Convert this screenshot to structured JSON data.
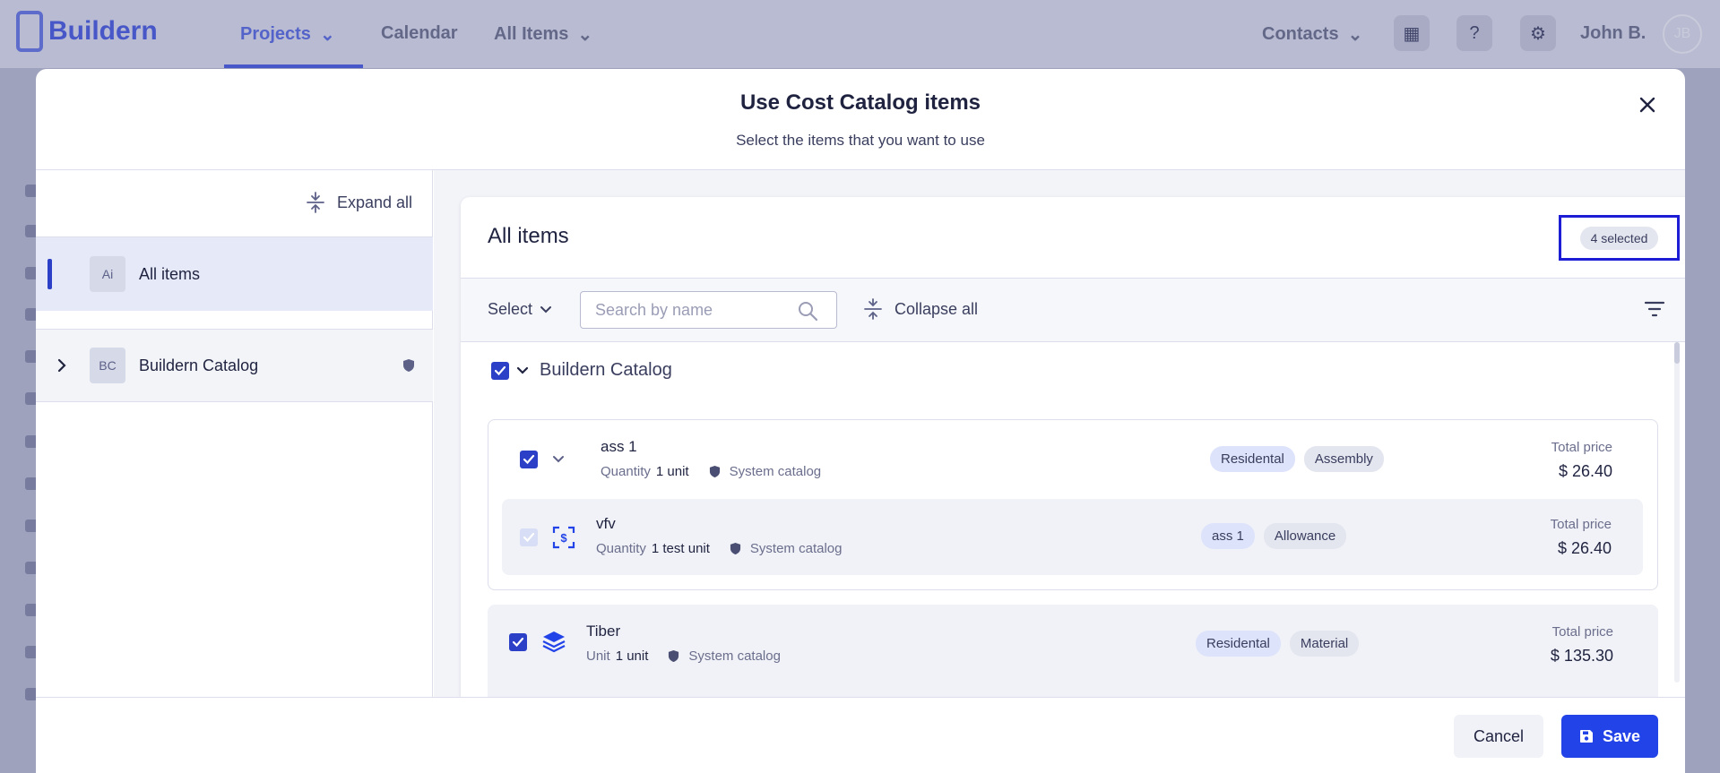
{
  "app": {
    "brand": "Buildern",
    "nav": [
      {
        "label": "Projects"
      },
      {
        "label": "Calendar"
      },
      {
        "label": "All Items"
      }
    ],
    "contacts_label": "Contacts",
    "user_name": "John B.",
    "user_initials": "JB"
  },
  "modal": {
    "title": "Use Cost Catalog items",
    "subtitle": "Select the items that you want to use",
    "expand_all_label": "Expand all",
    "tree": [
      {
        "initials": "Ai",
        "label": "All items",
        "selected": true
      },
      {
        "initials": "BC",
        "label": "Buildern Catalog",
        "selected": false
      }
    ],
    "main": {
      "title": "All items",
      "selected_count": "4 selected",
      "select_label": "Select",
      "search_placeholder": "Search by name",
      "search_value": "",
      "collapse_all_label": "Collapse all",
      "group": {
        "label": "Buildern Catalog",
        "checked": true
      },
      "items": [
        {
          "name": "ass 1",
          "qty_label": "Quantity",
          "qty_value": "1 unit",
          "source": "System catalog",
          "tags": [
            "Residental",
            "Assembly"
          ],
          "price_label": "Total price",
          "price": "$ 26.40",
          "checked": true,
          "children": [
            {
              "name": "vfv",
              "qty_label": "Quantity",
              "qty_value": "1 test unit",
              "source": "System catalog",
              "tags": [
                "ass 1",
                "Allowance"
              ],
              "price_label": "Total price",
              "price": "$ 26.40",
              "checked": true,
              "disabled": true
            }
          ]
        },
        {
          "name": "Tiber",
          "qty_label": "Unit",
          "qty_value": "1 unit",
          "source": "System catalog",
          "tags": [
            "Residental",
            "Material"
          ],
          "price_label": "Total price",
          "price": "$ 135.30",
          "checked": true
        }
      ]
    },
    "footer": {
      "cancel_label": "Cancel",
      "save_label": "Save"
    }
  },
  "colors": {
    "accent": "#2243e8",
    "highlight_frame": "#1d1dd6",
    "tag_blue": "#dde3fb",
    "tag_gray": "#e3e5ef"
  }
}
